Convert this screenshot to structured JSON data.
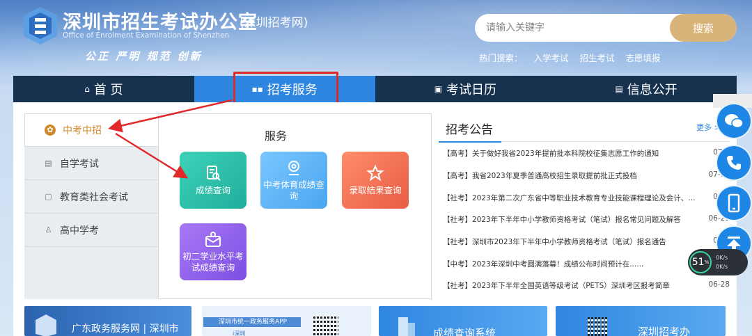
{
  "header": {
    "title": "深圳市招生考试办公室",
    "subtitle": "(深圳招考网)",
    "title_en": "Office of Enrolment Examination of Shenzhen",
    "slogan": "公正 严明 规范 创新",
    "search": {
      "placeholder": "请输入关键字",
      "button": "搜索"
    },
    "hot_label": "热门搜索：",
    "hot_links": [
      "入学考试",
      "招生考试",
      "志愿填报"
    ]
  },
  "nav": {
    "items": [
      {
        "label": "首 页",
        "icon": "home-icon"
      },
      {
        "label": "招考服务",
        "icon": "grid-icon"
      },
      {
        "label": "考试日历",
        "icon": "calendar-icon"
      },
      {
        "label": "信息公开",
        "icon": "document-icon"
      }
    ],
    "active": 1
  },
  "sidebar": {
    "items": [
      {
        "label": "中考中招",
        "icon": "gear-icon"
      },
      {
        "label": "自学考试",
        "icon": "document-icon"
      },
      {
        "label": "教育类社会考试",
        "icon": "book-icon"
      },
      {
        "label": "高中学考",
        "icon": "user-icon"
      }
    ],
    "active": 0
  },
  "services": {
    "heading": "服务",
    "tiles": [
      {
        "label": "成绩查询",
        "icon": "doc-search-icon",
        "color": "#1fae9c"
      },
      {
        "label": "中考体育成绩查询",
        "icon": "location-search-icon",
        "color": "#4aa6ef"
      },
      {
        "label": "录取结果查询",
        "icon": "star-icon",
        "color": "#e85c45"
      },
      {
        "label": "初二学业水平考试成绩查询",
        "icon": "mail-search-icon",
        "color": "#7d4fe3"
      }
    ]
  },
  "notices": {
    "title": "招考公告",
    "more": "更多 >",
    "items": [
      {
        "text": "【高考】关于做好我省2023年提前批本科院校征集志愿工作的通知",
        "date": "07-1"
      },
      {
        "text": "【高考】我省2023年夏季普通高校招生录取提前批正式投档",
        "date": "07-12"
      },
      {
        "text": "【社考】2023年第二次广东省中等职业技术教育专业技能课程理论及会计、美...",
        "date": "06-3"
      },
      {
        "text": "【社考】2023年下半年中小学教师资格考试（笔试）报名常见问题及解答",
        "date": "06-29"
      },
      {
        "text": "【社考】深圳市2023年下半年中小学教师资格考试（笔试）报名通告",
        "date": "06-2"
      },
      {
        "text": "【中考】2023年深圳中考圆满落幕！成绩公布时间预计在......",
        "date": ""
      },
      {
        "text": "【社考】2023年下半年全国英语等级考试（PETS）深圳考区报考简章",
        "date": "06-28"
      }
    ]
  },
  "network_widget": {
    "percent": "51",
    "unit": "%",
    "up": "0K/s",
    "down": "0K/s"
  },
  "banners": [
    {
      "text": "广东政务服务网 | 深圳市"
    },
    {
      "text": "深圳市统一政务服务APP",
      "sub": "i深圳"
    },
    {
      "text": "成绩查询系统"
    },
    {
      "text": "深圳招考办"
    }
  ],
  "colors": {
    "nav_bg": "#17324f",
    "nav_active": "#2f86e0",
    "accent": "#d3892e",
    "search_btn": "#d9b47a",
    "highlight": "#e02a2a"
  }
}
